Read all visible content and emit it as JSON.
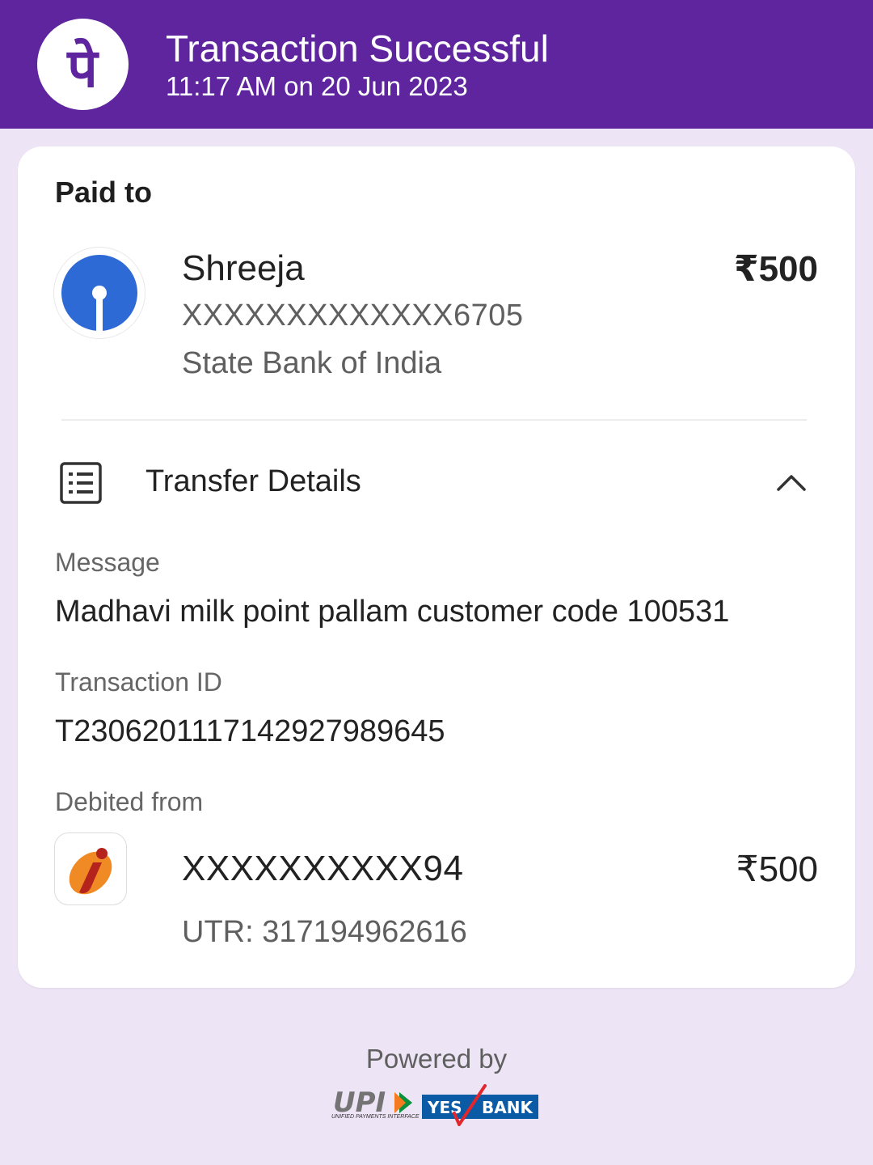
{
  "header": {
    "title": "Transaction Successful",
    "subtitle": "11:17 AM on 20 Jun 2023",
    "logo_glyph": "पे",
    "bg_color": "#5f259f"
  },
  "paid_to": {
    "label": "Paid to",
    "name": "Shreeja",
    "amount": "₹500",
    "account": "XXXXXXXXXXXXX6705",
    "bank": "State Bank of India",
    "bank_icon": "sbi-logo-icon"
  },
  "transfer_details": {
    "title": "Transfer Details",
    "icon": "receipt-list-icon",
    "toggle_icon": "chevron-up-icon",
    "message_label": "Message",
    "message_value": "Madhavi milk point pallam customer code 100531",
    "transaction_id_label": "Transaction ID",
    "transaction_id_value": "T2306201117142927989645",
    "debited_from_label": "Debited from",
    "debit_account": "XXXXXXXXXX94",
    "debit_amount": "₹500",
    "utr": "UTR: 317194962616",
    "debit_bank_icon": "icici-logo-icon"
  },
  "footer": {
    "powered_by": "Powered by",
    "upi_text": "UPI",
    "upi_subtext": "UNIFIED PAYMENTS INTERFACE",
    "yes_text": "YES",
    "bank_text": "BANK"
  }
}
